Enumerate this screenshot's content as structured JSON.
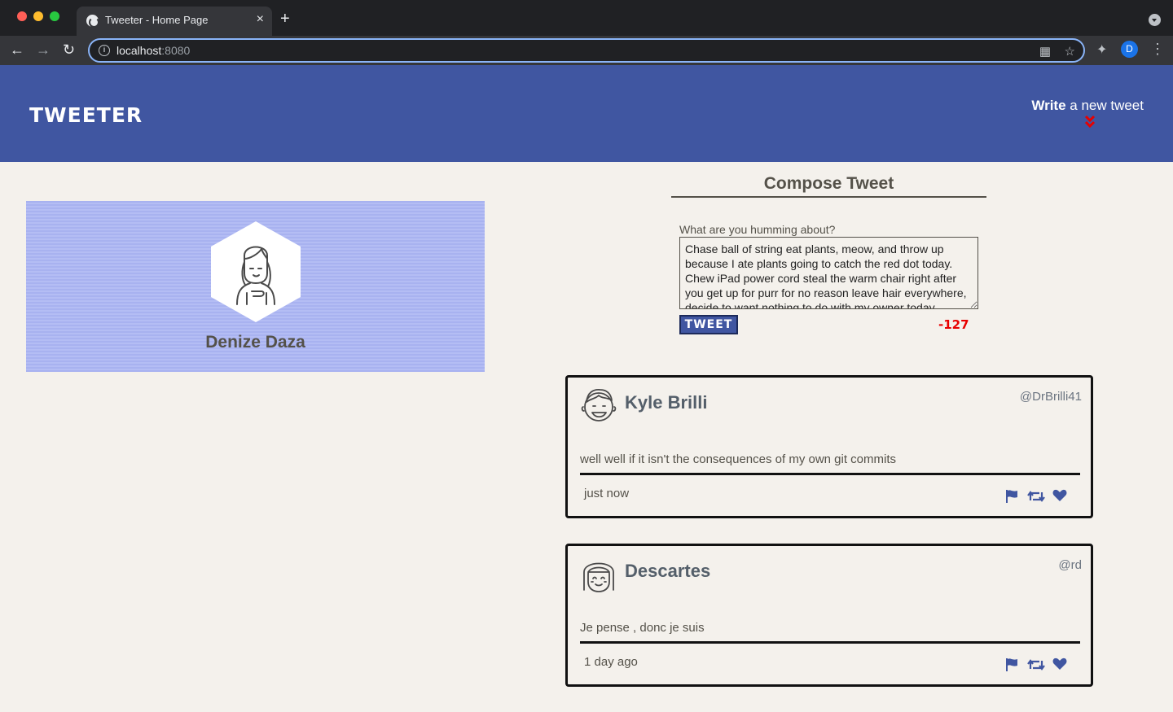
{
  "browser": {
    "tab_title": "Tweeter - Home Page",
    "tab_close": "×",
    "new_tab": "+",
    "url_host": "localhost",
    "url_port": ":8080",
    "profile_initial": "D"
  },
  "header": {
    "brand": "TWEETER",
    "write_bold": "Write",
    "write_rest": " a new tweet"
  },
  "profile": {
    "name": "Denize Daza"
  },
  "compose": {
    "title": "Compose Tweet",
    "label": "What are you humming about?",
    "text": "Chase ball of string eat plants, meow, and throw up because I ate plants going to catch the red dot today. Chew iPad power cord steal the warm chair right after you get up for purr for no reason leave hair everywhere, decide to want nothing to do with my owner today.",
    "button": "TWEET",
    "counter": "-127"
  },
  "tweets": [
    {
      "name": "Kyle Brilli",
      "handle": "@DrBrilli41",
      "body": "well well if it isn't the consequences of my own git commits",
      "time": "just now"
    },
    {
      "name": "Descartes",
      "handle": "@rd",
      "body": "Je pense , donc je suis",
      "time": "1 day ago"
    }
  ],
  "colors": {
    "navbar": "#4056a1",
    "background": "#f4f1ec",
    "profile_card": "#a8b2f0",
    "counter": "#e80000",
    "action_icons": "#4056a1"
  },
  "icons": {
    "tweet_actions": [
      "flag-icon",
      "retweet-icon",
      "heart-icon"
    ],
    "chevron": "double-chevron-down-icon"
  }
}
